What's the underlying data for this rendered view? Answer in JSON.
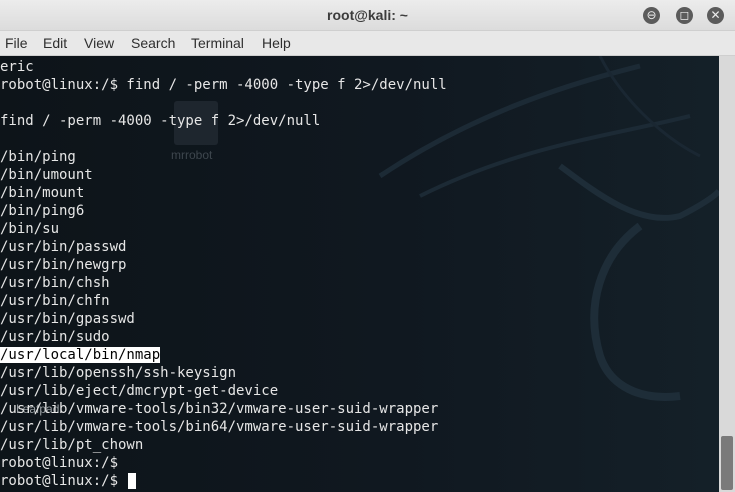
{
  "window": {
    "title": "root@kali: ~"
  },
  "window_controls": {
    "minimize_glyph": "⊖",
    "maximize_glyph": "◻",
    "close_glyph": "✕"
  },
  "menubar": {
    "items": [
      "File",
      "Edit",
      "View",
      "Search",
      "Terminal",
      "Help"
    ]
  },
  "desktop_ghosts": {
    "icon_label": "mrrobot",
    "taskbar_label": "Leafpad"
  },
  "terminal": {
    "lines": [
      {
        "text": "eric"
      },
      {
        "text": "robot@linux:/$ find / -perm -4000 -type f 2>/dev/null"
      },
      {
        "text": ""
      },
      {
        "text": "find / -perm -4000 -type f 2>/dev/null"
      },
      {
        "text": ""
      },
      {
        "text": "/bin/ping"
      },
      {
        "text": "/bin/umount"
      },
      {
        "text": "/bin/mount"
      },
      {
        "text": "/bin/ping6"
      },
      {
        "text": "/bin/su"
      },
      {
        "text": "/usr/bin/passwd"
      },
      {
        "text": "/usr/bin/newgrp"
      },
      {
        "text": "/usr/bin/chsh"
      },
      {
        "text": "/usr/bin/chfn"
      },
      {
        "text": "/usr/bin/gpasswd"
      },
      {
        "text": "/usr/bin/sudo"
      },
      {
        "text": "/usr/local/bin/nmap",
        "highlight": true
      },
      {
        "text": "/usr/lib/openssh/ssh-keysign"
      },
      {
        "text": "/usr/lib/eject/dmcrypt-get-device"
      },
      {
        "text": "/usr/lib/vmware-tools/bin32/vmware-user-suid-wrapper"
      },
      {
        "text": "/usr/lib/vmware-tools/bin64/vmware-user-suid-wrapper"
      },
      {
        "text": "/usr/lib/pt_chown"
      },
      {
        "text": "robot@linux:/$"
      },
      {
        "text": "robot@linux:/$ ",
        "cursor": true
      }
    ]
  },
  "colors": {
    "terminal_bg": "#0c1218",
    "terminal_fg": "#e6e6e6",
    "highlight_bg": "#ffffff"
  }
}
